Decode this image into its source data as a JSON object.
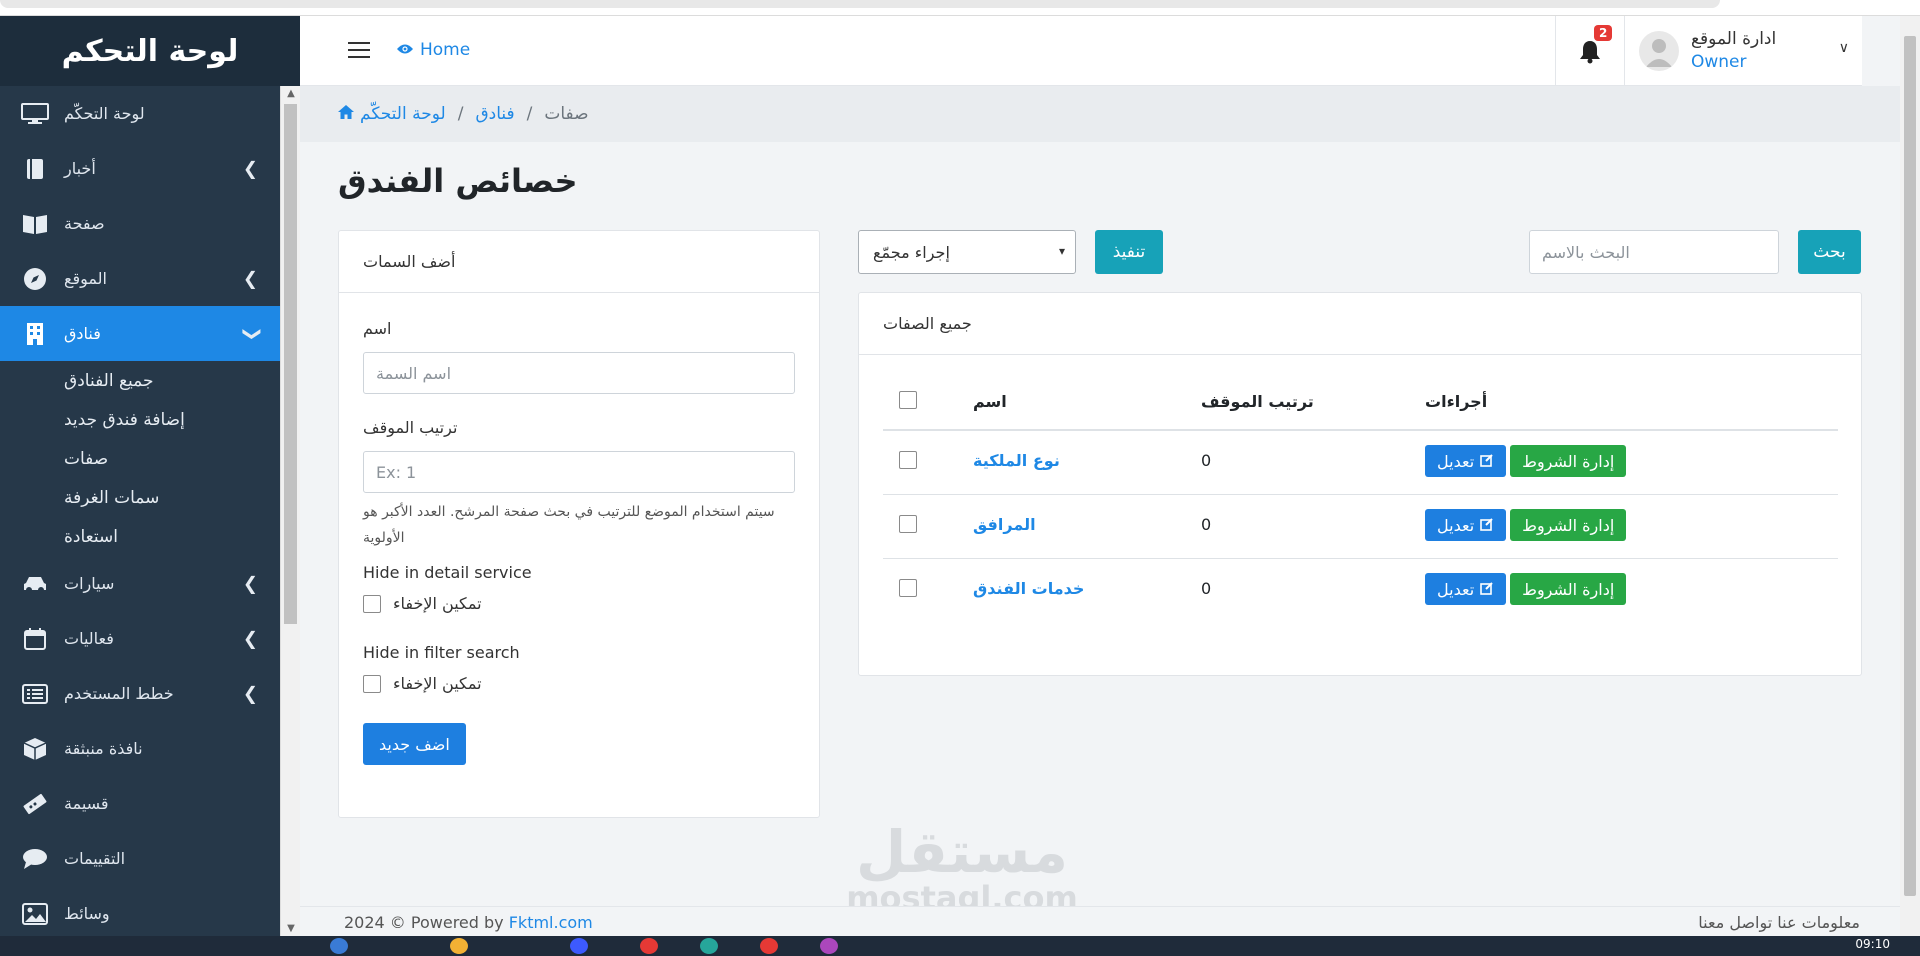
{
  "sidebar": {
    "brand": "لوحة التحكم",
    "items": [
      {
        "label": "لوحة التحكّم",
        "icon": "monitor-icon"
      },
      {
        "label": "أخبار",
        "icon": "book-icon"
      },
      {
        "label": "صفحة",
        "icon": "book-open-icon"
      },
      {
        "label": "الموقع",
        "icon": "compass-icon"
      },
      {
        "label": "فنادق",
        "icon": "building-icon"
      },
      {
        "label": "سيارات",
        "icon": "car-icon"
      },
      {
        "label": "فعاليات",
        "icon": "calendar-icon"
      },
      {
        "label": "خطط المستخدم",
        "icon": "list-icon"
      },
      {
        "label": "نافذة منبثقة",
        "icon": "box-icon"
      },
      {
        "label": "قسيمة",
        "icon": "ticket-icon"
      },
      {
        "label": "التقييمات",
        "icon": "comment-icon"
      },
      {
        "label": "وسائط",
        "icon": "image-icon"
      }
    ],
    "hotel_sub": [
      "جميع الفنادق",
      "إضافة فندق جديد",
      "صفات",
      "سمات الغرفة",
      "استعادة"
    ]
  },
  "header": {
    "home_label": "Home",
    "notification_count": "2",
    "user_name": "ادارة الموقع",
    "user_role": "Owner"
  },
  "breadcrumb": {
    "home": "لوحة التحكّم",
    "parent": "فنادق",
    "current": "صفات",
    "separator": "/"
  },
  "page_title": "خصائص الفندق",
  "add_form": {
    "heading": "أضف السمات",
    "name_label": "اسم",
    "name_placeholder": "اسم السمة",
    "order_label": "ترتيب الموقف",
    "order_placeholder": "Ex: 1",
    "order_help": "سيتم استخدام الموضع للترتيب في بحث صفحة المرشح. العدد الأكبر هو الأولوية",
    "hide_detail_label": "Hide in detail service",
    "hide_detail_check": "تمكين الإخفاء",
    "hide_filter_label": "Hide in filter search",
    "hide_filter_check": "تمكين الإخفاء",
    "submit": "اضف جديد"
  },
  "filters": {
    "bulk_action": "إجراء مجمّع",
    "apply": "تنفيذ",
    "search_placeholder": "البحث بالاسم",
    "search_button": "بحث"
  },
  "list": {
    "heading": "جميع الصفات",
    "columns": {
      "name": "اسم",
      "order": "ترتيب الموقف",
      "actions": "أجراءات"
    },
    "rows": [
      {
        "name": "نوع الملكية",
        "order": "0"
      },
      {
        "name": "المرافق",
        "order": "0"
      },
      {
        "name": "خدمات الفندق",
        "order": "0"
      }
    ],
    "edit_label": "تعديل",
    "manage_label": "إدارة الشروط"
  },
  "footer": {
    "copyright": "2024 © Powered by",
    "brand_link": "Fktml.com",
    "links": "معلومات عنا   تواصل معنا"
  },
  "watermark": {
    "line1": "مستقل",
    "line2": "mostaql.com"
  },
  "taskbar": {
    "time": "09:10"
  },
  "colors": {
    "sidebar_bg": "#263849",
    "accent": "#1e88e5",
    "success": "#28a745",
    "info": "#17a2b8"
  }
}
